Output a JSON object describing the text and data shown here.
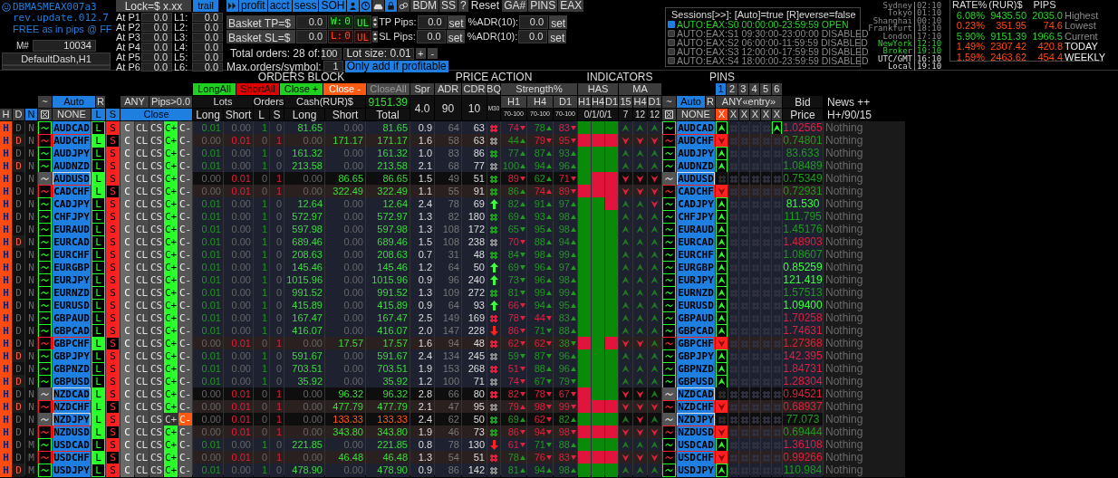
{
  "brand": {
    "title": "DBMASMEAX007a3",
    "revision": "rev.update.012.7",
    "tagline": "FREE as in pips @ FF",
    "magic_label": "M#",
    "magic": "10034",
    "profile": "DefaultDash,H1"
  },
  "lock": {
    "value": "Lock=$ x.xx",
    "trail": "trail"
  },
  "levels": [
    {
      "p": "At P1",
      "pv": "0.0",
      "l": "L1:",
      "lv": "0.0"
    },
    {
      "p": "At P2",
      "pv": "0.0",
      "l": "L2:",
      "lv": "0.0"
    },
    {
      "p": "At P3",
      "pv": "0.0",
      "l": "L3:",
      "lv": "0.0"
    },
    {
      "p": "At P4",
      "pv": "0.0",
      "l": "L4:",
      "lv": "0.0"
    },
    {
      "p": "At P5",
      "pv": "0.0",
      "l": "L5:",
      "lv": "0.0"
    },
    {
      "p": "At P6",
      "pv": "0.0",
      "l": "L6:",
      "lv": "0.0"
    }
  ],
  "toolbar": [
    {
      "kind": "icon"
    },
    {
      "kind": "blue",
      "label": "profit"
    },
    {
      "kind": "blue",
      "label": "acct"
    },
    {
      "kind": "blue",
      "label": "sess"
    },
    {
      "kind": "blue",
      "label": "SOH"
    },
    {
      "kind": "icon"
    },
    {
      "kind": "icon"
    },
    {
      "kind": "icon"
    },
    {
      "kind": "icon"
    },
    {
      "kind": "icon"
    },
    {
      "kind": "gray",
      "label": "BDM"
    },
    {
      "kind": "gray",
      "label": "SS"
    },
    {
      "kind": "gray",
      "label": "?"
    },
    {
      "kind": "plain",
      "label": "Reset"
    },
    {
      "kind": "gray",
      "label": "GA#"
    },
    {
      "kind": "gray",
      "label": "PINS"
    },
    {
      "kind": "gray",
      "label": "EAX"
    }
  ],
  "baskets": [
    {
      "label": "Basket TP=$",
      "value": "0.0",
      "win": true,
      "flag": "W:",
      "count": "0",
      "ul": "UL",
      "pips_label": "TP Pips:",
      "pips": "0.0",
      "set": "set",
      "adr_label": "%ADR(10):",
      "adr": "0.0",
      "set2": "set"
    },
    {
      "label": "Basket SL=$",
      "value": "0.0",
      "win": false,
      "flag": "L:",
      "count": "0",
      "ul": "UL",
      "pips_label": "SL Pips:",
      "pips": "0.0",
      "set": "set",
      "adr_label": "%ADR(10):",
      "adr": "0.0",
      "set2": "set"
    }
  ],
  "orders": {
    "total_label": "Total orders: 28 of:",
    "max": "100",
    "lot": "Lot size: 0.01",
    "plus": "+",
    "minus": "-",
    "per_symbol_label": "Max.orders/symbol:",
    "per_symbol": "1",
    "only_profitable": "Only add if profitable"
  },
  "sessions": {
    "title": "Sessions[>>]: [Auto]=true [R]everse=false",
    "items": [
      {
        "label": "AUTO:EAX:S0 00:00:00-23:59:59 OPEN",
        "on": true
      },
      {
        "label": "AUTO:EAX:S1 09:30:00-23:00:00 DISABLED",
        "on": false
      },
      {
        "label": "AUTO:EAX:S2 06:00:00-11:59:59 DISABLED",
        "on": false
      },
      {
        "label": "AUTO:EAX:S3 12:00:00-17:59:59 DISABLED",
        "on": false
      },
      {
        "label": "AUTO:EAX:S4 18:00:00-23:59:59 DISABLED",
        "on": false
      }
    ]
  },
  "clocks": [
    {
      "city": "Sydney",
      "time": "02:10",
      "dim": true,
      "live": false
    },
    {
      "city": "Tokyo",
      "time": "01:10",
      "dim": true,
      "live": false
    },
    {
      "city": "Shanghai",
      "time": "00:10",
      "dim": true,
      "live": false
    },
    {
      "city": "Frankfurt",
      "time": "18:10",
      "dim": true,
      "live": false
    },
    {
      "city": "London",
      "time": "17:10",
      "dim": true,
      "live": false
    },
    {
      "city": "NewYork",
      "time": "12:10",
      "dim": false,
      "live": true
    },
    {
      "city": "Broker",
      "time": "19:10",
      "dim": false,
      "live": true
    },
    {
      "city": "UTC/GMT",
      "time": "16:10",
      "dim": false,
      "live": false
    },
    {
      "city": "Local",
      "time": "19:10",
      "dim": false,
      "live": false
    }
  ],
  "stats": {
    "columns": [
      "RATE%",
      "(RUR)$",
      "PIPS"
    ],
    "rows": [
      {
        "rate": "6.08%",
        "cash": "9435.50",
        "pips": "2035.0",
        "label": "Highest",
        "gain": true,
        "emph": false
      },
      {
        "rate": "0.23%",
        "cash": "351.95",
        "pips": "74.6",
        "label": "Lowest",
        "gain": false,
        "emph": false
      },
      {
        "rate": "5.90%",
        "cash": "9151.39",
        "pips": "1966.5",
        "label": "Current",
        "gain": true,
        "emph": false
      },
      {
        "rate": "1.49%",
        "cash": "2307.42",
        "pips": "420.8",
        "label": "TODAY",
        "gain": false,
        "emph": true
      },
      {
        "rate": "1.59%",
        "cash": "2463.62",
        "pips": "454.4",
        "label": "WEEKLY",
        "gain": false,
        "emph": true
      }
    ]
  },
  "header": {
    "orders_title": "ORDERS BLOCK",
    "price_title": "PRICE ACTION",
    "ind_title": "INDICATORS",
    "pins_title": "PINS",
    "bulk": [
      "LongAll",
      "ShortAll",
      "Close +",
      "Close -",
      "CloseAll"
    ],
    "left_mode": {
      "tilde": "~",
      "auto": "Auto",
      "r": "R"
    },
    "any": "ANY",
    "pips_filter": "Pips>0.0",
    "flags": [
      "H",
      "D",
      "N"
    ],
    "none": "NONE",
    "l": "L",
    "s": "S",
    "close": "Close",
    "lots": "Lots",
    "orders": "Orders",
    "cash": "Cash(RUR)$",
    "cash_total": "9151.39",
    "sub": [
      "Long",
      "Short",
      "L",
      "S",
      "Long",
      "Short",
      "Total"
    ],
    "spr": "Spr",
    "adr": "ADR",
    "cdr": "CDR",
    "bq": "BQ",
    "spr_v": "4.0",
    "adr_v": "90",
    "cdr_v": "10",
    "bq_v": "M30",
    "strength": "Strength%",
    "tf": [
      "H1",
      "H4",
      "D1"
    ],
    "tf_range": [
      "70-100",
      "70-100",
      "70-100"
    ],
    "has": "HAS",
    "ma": "MA",
    "has_tf": [
      "H1",
      "H4",
      "D1"
    ],
    "ma_tf": [
      "15",
      "H4",
      "D1"
    ],
    "has_v": "0/1/0/1",
    "ma_v": [
      "7",
      "12",
      "12"
    ],
    "right_mode": {
      "tilde": "~",
      "auto": "Auto",
      "r": "R"
    },
    "right_none": "NONE",
    "pin_tabs": [
      {
        "label": "1",
        "selected": true
      },
      {
        "label": "2",
        "selected": false
      },
      {
        "label": "3",
        "selected": false
      },
      {
        "label": "4",
        "selected": false
      },
      {
        "label": "5",
        "selected": false
      },
      {
        "label": "6",
        "selected": false
      }
    ],
    "entry": "ANY«entry»",
    "pin_x": [
      {
        "label": "X",
        "on": true
      },
      {
        "label": "X",
        "on": false
      },
      {
        "label": "X",
        "on": false
      },
      {
        "label": "X",
        "on": false
      },
      {
        "label": "X",
        "on": false
      },
      {
        "label": "X",
        "on": false
      }
    ],
    "bid": "Bid",
    "price": "Price",
    "news": "News ++",
    "news_v": "H+/90/15"
  },
  "rows": [
    {
      "sym": "AUDCAD",
      "long": true,
      "idle": false,
      "d": false,
      "cm": false,
      "loss": false,
      "hit": true,
      "btn": [
        "H",
        "D",
        "N",
        "L",
        "S",
        "C",
        "CL",
        "CS",
        "C+",
        "C-"
      ],
      "ll": "0.01",
      "ls": "0.00",
      "ol": "1",
      "os": "0",
      "cl": "81.65",
      "cs": "0.00",
      "tot": "81.65",
      "spr": "0.9",
      "adr": "64",
      "cdr": "63",
      "bq": {
        "kind": "hash",
        "color": "#e0203c"
      },
      "st": [
        [
          "74",
          false,
          false
        ],
        [
          "78",
          true,
          true
        ],
        [
          "83",
          false,
          false
        ]
      ],
      "has": [
        true,
        true,
        true
      ],
      "ma": [
        true,
        true,
        true
      ],
      "sym2": "AUDCAD",
      "bid": {
        "value": "1.02565",
        "color": "#e0203c"
      },
      "news": "Nothing"
    },
    {
      "sym": "AUDCHF",
      "long": false,
      "idle": false,
      "d": true,
      "cm": false,
      "loss": false,
      "hit": false,
      "btn": [
        "H",
        "D",
        "N",
        "L",
        "S",
        "C",
        "CL",
        "CS",
        "C+",
        "C-"
      ],
      "ll": "0.00",
      "ls": "0.01",
      "ol": "0",
      "os": "1",
      "cl": "0.00",
      "cs": "171.17",
      "tot": "171.17",
      "spr": "1.6",
      "adr": "58",
      "cdr": "63",
      "bq": {
        "kind": "hash",
        "color": "#8a8a8a"
      },
      "st": [
        [
          "44",
          true,
          true
        ],
        [
          "79",
          false,
          false
        ],
        [
          "95",
          false,
          false
        ]
      ],
      "has": [
        false,
        false,
        false
      ],
      "ma": [
        false,
        false,
        false
      ],
      "sym2": "AUDCHF",
      "bid": {
        "value": "0.74801",
        "color": "#1f9a1f"
      },
      "news": "Nothing"
    },
    {
      "sym": "AUDJPY",
      "long": true,
      "idle": false,
      "d": false,
      "cm": false,
      "loss": false,
      "hit": false,
      "btn": [
        "H",
        "D",
        "N",
        "L",
        "S",
        "C",
        "CL",
        "CS",
        "C+",
        "C-"
      ],
      "ll": "0.01",
      "ls": "0.00",
      "ol": "1",
      "os": "0",
      "cl": "161.32",
      "cs": "0.00",
      "tot": "161.32",
      "spr": "1.0",
      "adr": "83",
      "cdr": "86",
      "bq": {
        "kind": "hash",
        "color": "#1f9a1f"
      },
      "st": [
        [
          "77",
          true,
          true
        ],
        [
          "87",
          true,
          true
        ],
        [
          "93",
          true,
          true
        ]
      ],
      "has": [
        true,
        true,
        true
      ],
      "ma": [
        true,
        true,
        true
      ],
      "sym2": "AUDJPY",
      "bid": {
        "value": "83.633",
        "color": "#1f9a1f"
      },
      "news": "Nothing"
    },
    {
      "sym": "AUDNZD",
      "long": true,
      "idle": false,
      "d": true,
      "cm": false,
      "loss": false,
      "hit": false,
      "btn": [
        "H",
        "D",
        "N",
        "L",
        "S",
        "C",
        "CL",
        "CS",
        "C+",
        "C-"
      ],
      "ll": "0.01",
      "ls": "0.00",
      "ol": "1",
      "os": "0",
      "cl": "213.58",
      "cs": "0.00",
      "tot": "213.58",
      "spr": "2.1",
      "adr": "68",
      "cdr": "77",
      "bq": {
        "kind": "hash",
        "color": "#8a8a8a"
      },
      "st": [
        [
          "100",
          true,
          true
        ],
        [
          "94",
          true,
          true
        ],
        [
          "96",
          true,
          true
        ]
      ],
      "has": [
        true,
        true,
        true
      ],
      "ma": [
        true,
        true,
        true
      ],
      "sym2": "AUDNZD",
      "bid": {
        "value": "1.08489",
        "color": "#1f9a1f"
      },
      "news": "Nothing"
    },
    {
      "sym": "AUDUSD",
      "long": false,
      "idle": true,
      "d": false,
      "cm": false,
      "loss": false,
      "hit": false,
      "btn": [
        "H",
        "D",
        "N",
        "L",
        "S",
        "C",
        "CL",
        "CS",
        "C+",
        "C-"
      ],
      "ll": "0.00",
      "ls": "0.01",
      "ol": "0",
      "os": "1",
      "cl": "0.00",
      "cs": "86.65",
      "tot": "86.65",
      "spr": "1.5",
      "adr": "49",
      "cdr": "51",
      "bq": {
        "kind": "hash",
        "color": "#1f9a1f"
      },
      "st": [
        [
          "89",
          false,
          false
        ],
        [
          "62",
          true,
          true
        ],
        [
          "71",
          false,
          false
        ]
      ],
      "has": [
        true,
        false,
        false
      ],
      "ma": [
        false,
        false,
        false
      ],
      "sym2": "AUDUSD",
      "bid": {
        "value": "0.75349",
        "color": "#1f9a1f"
      },
      "news": "Nothing"
    },
    {
      "sym": "CADCHF",
      "long": false,
      "idle": false,
      "d": false,
      "cm": false,
      "loss": false,
      "hit": false,
      "btn": [
        "H",
        "D",
        "N",
        "L",
        "S",
        "C",
        "CL",
        "CS",
        "C+",
        "C-"
      ],
      "ll": "0.00",
      "ls": "0.01",
      "ol": "0",
      "os": "1",
      "cl": "0.00",
      "cs": "322.49",
      "tot": "322.49",
      "spr": "1.1",
      "adr": "55",
      "cdr": "91",
      "bq": {
        "kind": "hash",
        "color": "#1f9a1f"
      },
      "st": [
        [
          "86",
          true,
          true
        ],
        [
          "74",
          true,
          false
        ],
        [
          "89",
          false,
          false
        ]
      ],
      "has": [
        false,
        false,
        false
      ],
      "ma": [
        false,
        false,
        false
      ],
      "sym2": "CADCHF",
      "bid": {
        "value": "0.72931",
        "color": "#1f9a1f"
      },
      "news": "Nothing"
    },
    {
      "sym": "CADJPY",
      "long": true,
      "idle": false,
      "d": false,
      "cm": false,
      "loss": false,
      "hit": false,
      "btn": [
        "H",
        "D",
        "N",
        "L",
        "S",
        "C",
        "CL",
        "CS",
        "C+",
        "C-"
      ],
      "ll": "0.01",
      "ls": "0.00",
      "ol": "1",
      "os": "0",
      "cl": "12.64",
      "cs": "0.00",
      "tot": "12.64",
      "spr": "2.4",
      "adr": "78",
      "cdr": "69",
      "bq": {
        "kind": "up",
        "color": "#3cff3c"
      },
      "st": [
        [
          "82",
          true,
          true
        ],
        [
          "91",
          true,
          true
        ],
        [
          "97",
          true,
          true
        ]
      ],
      "has": [
        true,
        true,
        false
      ],
      "ma": [
        true,
        true,
        false
      ],
      "sym2": "CADJPY",
      "bid": {
        "value": "81.530",
        "color": "#3cff3c"
      },
      "news": "Nothing"
    },
    {
      "sym": "CHFJPY",
      "long": true,
      "idle": false,
      "d": false,
      "cm": false,
      "loss": false,
      "hit": false,
      "btn": [
        "H",
        "D",
        "N",
        "L",
        "S",
        "C",
        "CL",
        "CS",
        "C+",
        "C-"
      ],
      "ll": "0.01",
      "ls": "0.00",
      "ol": "1",
      "os": "0",
      "cl": "572.97",
      "cs": "0.00",
      "tot": "572.97",
      "spr": "1.3",
      "adr": "82",
      "cdr": "180",
      "bq": {
        "kind": "hash",
        "color": "#1f9a1f"
      },
      "st": [
        [
          "69",
          true,
          true
        ],
        [
          "93",
          true,
          true
        ],
        [
          "98",
          true,
          true
        ]
      ],
      "has": [
        true,
        true,
        true
      ],
      "ma": [
        true,
        true,
        true
      ],
      "sym2": "CHFJPY",
      "bid": {
        "value": "111.795",
        "color": "#1f9a1f"
      },
      "news": "Nothing"
    },
    {
      "sym": "EURAUD",
      "long": true,
      "idle": false,
      "d": false,
      "cm": false,
      "loss": false,
      "hit": false,
      "btn": [
        "H",
        "D",
        "N",
        "L",
        "S",
        "C",
        "CL",
        "CS",
        "C+",
        "C-"
      ],
      "ll": "0.01",
      "ls": "0.00",
      "ol": "1",
      "os": "0",
      "cl": "597.98",
      "cs": "0.00",
      "tot": "597.98",
      "spr": "1.3",
      "adr": "108",
      "cdr": "172",
      "bq": {
        "kind": "hash",
        "color": "#1f9a1f"
      },
      "st": [
        [
          "65",
          false,
          true
        ],
        [
          "95",
          true,
          true
        ],
        [
          "98",
          true,
          true
        ]
      ],
      "has": [
        true,
        true,
        true
      ],
      "ma": [
        true,
        true,
        true
      ],
      "sym2": "EURAUD",
      "bid": {
        "value": "1.45176",
        "color": "#1f9a1f"
      },
      "news": "Nothing"
    },
    {
      "sym": "EURCAD",
      "long": true,
      "idle": false,
      "d": true,
      "cm": false,
      "loss": false,
      "hit": false,
      "btn": [
        "H",
        "D",
        "N",
        "L",
        "S",
        "C",
        "CL",
        "CS",
        "C+",
        "C-"
      ],
      "ll": "0.01",
      "ls": "0.00",
      "ol": "1",
      "os": "0",
      "cl": "689.46",
      "cs": "0.00",
      "tot": "689.46",
      "spr": "1.5",
      "adr": "108",
      "cdr": "238",
      "bq": {
        "kind": "hash",
        "color": "#8a8a8a"
      },
      "st": [
        [
          "70",
          false,
          false
        ],
        [
          "88",
          true,
          true
        ],
        [
          "94",
          true,
          true
        ]
      ],
      "has": [
        true,
        true,
        true
      ],
      "ma": [
        true,
        true,
        true
      ],
      "sym2": "EURCAD",
      "bid": {
        "value": "1.48903",
        "color": "#e0203c"
      },
      "news": "Nothing"
    },
    {
      "sym": "EURCHF",
      "long": true,
      "idle": false,
      "d": false,
      "cm": false,
      "loss": false,
      "hit": false,
      "btn": [
        "H",
        "D",
        "N",
        "L",
        "S",
        "C",
        "CL",
        "CS",
        "C+",
        "C-"
      ],
      "ll": "0.01",
      "ls": "0.00",
      "ol": "1",
      "os": "0",
      "cl": "208.63",
      "cs": "0.00",
      "tot": "208.63",
      "spr": "0.7",
      "adr": "31",
      "cdr": "48",
      "bq": {
        "kind": "hash",
        "color": "#1f9a1f"
      },
      "st": [
        [
          "84",
          false,
          true
        ],
        [
          "98",
          true,
          true
        ],
        [
          "99",
          true,
          true
        ]
      ],
      "has": [
        true,
        true,
        true
      ],
      "ma": [
        true,
        true,
        true
      ],
      "sym2": "EURCHF",
      "bid": {
        "value": "1.08607",
        "color": "#1f9a1f"
      },
      "news": "Nothing"
    },
    {
      "sym": "EURGBP",
      "long": true,
      "idle": false,
      "d": false,
      "cm": false,
      "loss": false,
      "hit": false,
      "btn": [
        "H",
        "D",
        "N",
        "L",
        "S",
        "C",
        "CL",
        "CS",
        "C+",
        "C-"
      ],
      "ll": "0.01",
      "ls": "0.00",
      "ol": "1",
      "os": "0",
      "cl": "145.46",
      "cs": "0.00",
      "tot": "145.46",
      "spr": "1.2",
      "adr": "64",
      "cdr": "50",
      "bq": {
        "kind": "up",
        "color": "#3cff3c"
      },
      "st": [
        [
          "69",
          false,
          true
        ],
        [
          "96",
          true,
          true
        ],
        [
          "97",
          true,
          true
        ]
      ],
      "has": [
        true,
        true,
        true
      ],
      "ma": [
        true,
        true,
        true
      ],
      "sym2": "EURGBP",
      "bid": {
        "value": "0.85259",
        "color": "#3cff3c"
      },
      "news": "Nothing"
    },
    {
      "sym": "EURJPY",
      "long": true,
      "idle": false,
      "d": false,
      "cm": false,
      "loss": false,
      "hit": false,
      "btn": [
        "H",
        "D",
        "N",
        "L",
        "S",
        "C",
        "CL",
        "CS",
        "C+",
        "C-"
      ],
      "ll": "0.01",
      "ls": "0.00",
      "ol": "1",
      "os": "0",
      "cl": "1015.96",
      "cs": "0.00",
      "tot": "1015.96",
      "spr": "0.9",
      "adr": "96",
      "cdr": "240",
      "bq": {
        "kind": "up",
        "color": "#3cff3c"
      },
      "st": [
        [
          "73",
          false,
          true
        ],
        [
          "96",
          true,
          true
        ],
        [
          "98",
          true,
          true
        ]
      ],
      "has": [
        true,
        true,
        true
      ],
      "ma": [
        true,
        true,
        true
      ],
      "sym2": "EURJPY",
      "bid": {
        "value": "121.419",
        "color": "#3cff3c"
      },
      "news": "Nothing"
    },
    {
      "sym": "EURNZD",
      "long": true,
      "idle": false,
      "d": false,
      "cm": false,
      "loss": false,
      "hit": false,
      "btn": [
        "H",
        "D",
        "N",
        "L",
        "S",
        "C",
        "CL",
        "CS",
        "C+",
        "C-"
      ],
      "ll": "0.01",
      "ls": "0.00",
      "ol": "1",
      "os": "0",
      "cl": "991.52",
      "cs": "0.00",
      "tot": "991.52",
      "spr": "1.3",
      "adr": "109",
      "cdr": "272",
      "bq": {
        "kind": "hash",
        "color": "#1f9a1f"
      },
      "st": [
        [
          "81",
          false,
          true
        ],
        [
          "99",
          true,
          true
        ],
        [
          "99",
          true,
          true
        ]
      ],
      "has": [
        true,
        true,
        true
      ],
      "ma": [
        true,
        true,
        true
      ],
      "sym2": "EURNZD",
      "bid": {
        "value": "1.57513",
        "color": "#1f9a1f"
      },
      "news": "Nothing"
    },
    {
      "sym": "EURUSD",
      "long": true,
      "idle": false,
      "d": false,
      "cm": false,
      "loss": false,
      "hit": false,
      "btn": [
        "H",
        "D",
        "N",
        "L",
        "S",
        "C",
        "CL",
        "CS",
        "C+",
        "C-"
      ],
      "ll": "0.01",
      "ls": "0.00",
      "ol": "1",
      "os": "0",
      "cl": "415.89",
      "cs": "0.00",
      "tot": "415.89",
      "spr": "0.9",
      "adr": "64",
      "cdr": "93",
      "bq": {
        "kind": "up",
        "color": "#3cff3c"
      },
      "st": [
        [
          "66",
          false,
          false
        ],
        [
          "94",
          true,
          true
        ],
        [
          "95",
          true,
          true
        ]
      ],
      "has": [
        true,
        true,
        true
      ],
      "ma": [
        true,
        true,
        true
      ],
      "sym2": "EURUSD",
      "bid": {
        "value": "1.09400",
        "color": "#3cff3c"
      },
      "news": "Nothing"
    },
    {
      "sym": "GBPAUD",
      "long": true,
      "idle": false,
      "d": false,
      "cm": false,
      "loss": false,
      "hit": false,
      "btn": [
        "H",
        "D",
        "N",
        "L",
        "S",
        "C",
        "CL",
        "CS",
        "C+",
        "C-"
      ],
      "ll": "0.01",
      "ls": "0.00",
      "ol": "1",
      "os": "0",
      "cl": "167.47",
      "cs": "0.00",
      "tot": "167.47",
      "spr": "2.5",
      "adr": "149",
      "cdr": "169",
      "bq": {
        "kind": "hash",
        "color": "#e0203c"
      },
      "st": [
        [
          "78",
          false,
          false
        ],
        [
          "44",
          false,
          false
        ],
        [
          "83",
          true,
          true
        ]
      ],
      "has": [
        true,
        true,
        true
      ],
      "ma": [
        true,
        true,
        true
      ],
      "sym2": "GBPAUD",
      "bid": {
        "value": "1.70258",
        "color": "#e0203c"
      },
      "news": "Nothing"
    },
    {
      "sym": "GBPCAD",
      "long": true,
      "idle": false,
      "d": false,
      "cm": false,
      "loss": false,
      "hit": false,
      "btn": [
        "H",
        "D",
        "N",
        "L",
        "S",
        "C",
        "CL",
        "CS",
        "C+",
        "C-"
      ],
      "ll": "0.01",
      "ls": "0.00",
      "ol": "1",
      "os": "0",
      "cl": "416.07",
      "cs": "0.00",
      "tot": "416.07",
      "spr": "2.0",
      "adr": "147",
      "cdr": "228",
      "bq": {
        "kind": "down",
        "color": "#ff2020"
      },
      "st": [
        [
          "86",
          false,
          false
        ],
        [
          "71",
          false,
          true
        ],
        [
          "88",
          true,
          true
        ]
      ],
      "has": [
        true,
        true,
        true
      ],
      "ma": [
        true,
        true,
        true
      ],
      "sym2": "GBPCAD",
      "bid": {
        "value": "1.74631",
        "color": "#e0203c"
      },
      "news": "Nothing"
    },
    {
      "sym": "GBPCHF",
      "long": false,
      "idle": false,
      "d": false,
      "cm": false,
      "loss": false,
      "hit": false,
      "btn": [
        "H",
        "D",
        "N",
        "L",
        "S",
        "C",
        "CL",
        "CS",
        "C+",
        "C-"
      ],
      "ll": "0.00",
      "ls": "0.01",
      "ol": "0",
      "os": "1",
      "cl": "0.00",
      "cs": "17.57",
      "tot": "17.57",
      "spr": "1.6",
      "adr": "94",
      "cdr": "48",
      "bq": {
        "kind": "hash",
        "color": "#e0203c"
      },
      "st": [
        [
          "62",
          false,
          false
        ],
        [
          "62",
          false,
          false
        ],
        [
          "38",
          false,
          true
        ]
      ],
      "has": [
        false,
        true,
        false
      ],
      "ma": [
        false,
        false,
        true
      ],
      "sym2": "GBPCHF",
      "bid": {
        "value": "1.27368",
        "color": "#e0203c"
      },
      "news": "Nothing"
    },
    {
      "sym": "GBPJPY",
      "long": true,
      "idle": false,
      "d": true,
      "cm": false,
      "loss": false,
      "hit": false,
      "btn": [
        "H",
        "D",
        "N",
        "L",
        "S",
        "C",
        "CL",
        "CS",
        "C+",
        "C-"
      ],
      "ll": "0.01",
      "ls": "0.00",
      "ol": "1",
      "os": "0",
      "cl": "591.67",
      "cs": "0.00",
      "tot": "591.67",
      "spr": "2.4",
      "adr": "134",
      "cdr": "245",
      "bq": {
        "kind": "hash",
        "color": "#8a8a8a"
      },
      "st": [
        [
          "59",
          false,
          true
        ],
        [
          "87",
          false,
          true
        ],
        [
          "96",
          true,
          true
        ]
      ],
      "has": [
        true,
        true,
        true
      ],
      "ma": [
        true,
        true,
        true
      ],
      "sym2": "GBPJPY",
      "bid": {
        "value": "142.395",
        "color": "#e0203c"
      },
      "news": "Nothing"
    },
    {
      "sym": "GBPNZD",
      "long": true,
      "idle": false,
      "d": false,
      "cm": false,
      "loss": false,
      "hit": false,
      "btn": [
        "H",
        "D",
        "N",
        "L",
        "S",
        "C",
        "CL",
        "CS",
        "C+",
        "C-"
      ],
      "ll": "0.01",
      "ls": "0.00",
      "ol": "1",
      "os": "0",
      "cl": "703.51",
      "cs": "0.00",
      "tot": "703.51",
      "spr": "1.9",
      "adr": "153",
      "cdr": "268",
      "bq": {
        "kind": "hash",
        "color": "#e0203c"
      },
      "st": [
        [
          "51",
          false,
          false
        ],
        [
          "88",
          true,
          true
        ],
        [
          "96",
          true,
          true
        ]
      ],
      "has": [
        true,
        true,
        true
      ],
      "ma": [
        true,
        true,
        true
      ],
      "sym2": "GBPNZD",
      "bid": {
        "value": "1.84731",
        "color": "#e0203c"
      },
      "news": "Nothing"
    },
    {
      "sym": "GBPUSD",
      "long": true,
      "idle": false,
      "d": true,
      "cm": false,
      "loss": false,
      "hit": false,
      "btn": [
        "H",
        "D",
        "N",
        "L",
        "S",
        "C",
        "CL",
        "CS",
        "C+",
        "C-"
      ],
      "ll": "0.01",
      "ls": "0.00",
      "ol": "1",
      "os": "0",
      "cl": "35.92",
      "cs": "0.00",
      "tot": "35.92",
      "spr": "1.2",
      "adr": "100",
      "cdr": "71",
      "bq": {
        "kind": "hash",
        "color": "#8a8a8a"
      },
      "st": [
        [
          "74",
          false,
          false
        ],
        [
          "67",
          false,
          true
        ],
        [
          "79",
          false,
          true
        ]
      ],
      "has": [
        true,
        true,
        true
      ],
      "ma": [
        true,
        true,
        true
      ],
      "sym2": "GBPUSD",
      "bid": {
        "value": "1.28304",
        "color": "#e0203c"
      },
      "news": "Nothing"
    },
    {
      "sym": "NZDCAD",
      "long": false,
      "idle": true,
      "d": false,
      "cm": false,
      "loss": false,
      "hit": false,
      "btn": [
        "H",
        "D",
        "N",
        "L",
        "S",
        "C",
        "CL",
        "CS",
        "C+",
        "C-"
      ],
      "ll": "0.00",
      "ls": "0.01",
      "ol": "0",
      "os": "1",
      "cl": "0.00",
      "cs": "96.32",
      "tot": "96.32",
      "spr": "2.8",
      "adr": "66",
      "cdr": "80",
      "bq": {
        "kind": "hash",
        "color": "#e0203c"
      },
      "st": [
        [
          "82",
          false,
          false
        ],
        [
          "78",
          false,
          false
        ],
        [
          "67",
          false,
          false
        ]
      ],
      "has": [
        false,
        true,
        true
      ],
      "ma": [
        false,
        false,
        true
      ],
      "sym2": "NZDCAD",
      "bid": {
        "value": "0.94521",
        "color": "#e0203c"
      },
      "news": "Nothing"
    },
    {
      "sym": "NZDCHF",
      "long": false,
      "idle": false,
      "d": true,
      "cm": false,
      "loss": false,
      "hit": false,
      "btn": [
        "H",
        "D",
        "N",
        "L",
        "S",
        "C",
        "CL",
        "CS",
        "C+",
        "C-"
      ],
      "ll": "0.00",
      "ls": "0.01",
      "ol": "0",
      "os": "1",
      "cl": "0.00",
      "cs": "477.79",
      "tot": "477.79",
      "spr": "2.1",
      "adr": "47",
      "cdr": "95",
      "bq": {
        "kind": "hash",
        "color": "#8a8a8a"
      },
      "st": [
        [
          "79",
          true,
          false
        ],
        [
          "98",
          false,
          false
        ],
        [
          "99",
          false,
          false
        ]
      ],
      "has": [
        false,
        false,
        false
      ],
      "ma": [
        false,
        false,
        false
      ],
      "sym2": "NZDCHF",
      "bid": {
        "value": "0.68937",
        "color": "#e0203c"
      },
      "news": "Nothing"
    },
    {
      "sym": "NZDJPY",
      "long": false,
      "idle": true,
      "d": false,
      "cm": true,
      "loss": true,
      "hit": false,
      "btn": [
        "H",
        "D",
        "N",
        "L",
        "S",
        "C",
        "CL",
        "CS",
        "C+",
        "C-"
      ],
      "ll": "0.00",
      "ls": "0.01",
      "ol": "0",
      "os": "1",
      "cl": "0.00",
      "cs": "133.33",
      "tot": "133.33",
      "spr": "2.4",
      "adr": "62",
      "cdr": "50",
      "bq": {
        "kind": "hash",
        "color": "#1f9a1f"
      },
      "st": [
        [
          "69",
          true,
          true
        ],
        [
          "62",
          false,
          false
        ],
        [
          "82",
          true,
          true
        ]
      ],
      "has": [
        true,
        true,
        true
      ],
      "ma": [
        true,
        false,
        true
      ],
      "sym2": "NZDJPY",
      "bid": {
        "value": "77.073",
        "color": "#1f9a1f"
      },
      "news": "Nothing"
    },
    {
      "sym": "NZDUSD",
      "long": false,
      "idle": false,
      "d": false,
      "cm": false,
      "loss": false,
      "hit": false,
      "btn": [
        "H",
        "D",
        "N",
        "L",
        "S",
        "C",
        "CL",
        "CS",
        "C+",
        "C-"
      ],
      "ll": "0.00",
      "ls": "0.01",
      "ol": "0",
      "os": "1",
      "cl": "0.00",
      "cs": "343.80",
      "tot": "343.80",
      "spr": "1.9",
      "adr": "46",
      "cdr": "73",
      "bq": {
        "kind": "hash",
        "color": "#1f9a1f"
      },
      "st": [
        [
          "86",
          false,
          false
        ],
        [
          "94",
          false,
          false
        ],
        [
          "98",
          false,
          false
        ]
      ],
      "has": [
        false,
        false,
        false
      ],
      "ma": [
        false,
        false,
        false
      ],
      "sym2": "NZDUSD",
      "bid": {
        "value": "0.69444",
        "color": "#1f9a1f"
      },
      "news": "Nothing"
    },
    {
      "sym": "USDCAD",
      "long": true,
      "idle": false,
      "d": false,
      "cm": false,
      "loss": false,
      "hit": false,
      "btn": [
        "H",
        "D",
        "M",
        "L",
        "S",
        "C",
        "CL",
        "CS",
        "C+",
        "C-"
      ],
      "ll": "0.01",
      "ls": "0.00",
      "ol": "1",
      "os": "0",
      "cl": "221.85",
      "cs": "0.00",
      "tot": "221.85",
      "spr": "0.8",
      "adr": "78",
      "cdr": "130",
      "bq": {
        "kind": "down",
        "color": "#ff2020"
      },
      "st": [
        [
          "61",
          false,
          false
        ],
        [
          "71",
          false,
          true
        ],
        [
          "88",
          true,
          true
        ]
      ],
      "has": [
        true,
        true,
        true
      ],
      "ma": [
        true,
        true,
        true
      ],
      "sym2": "USDCAD",
      "bid": {
        "value": "1.36108",
        "color": "#e0203c"
      },
      "news": "Nothing"
    },
    {
      "sym": "USDCHF",
      "long": false,
      "idle": false,
      "d": false,
      "cm": false,
      "loss": false,
      "hit": false,
      "btn": [
        "H",
        "D",
        "M",
        "L",
        "S",
        "C",
        "CL",
        "CS",
        "C+",
        "C-"
      ],
      "ll": "0.00",
      "ls": "0.01",
      "ol": "0",
      "os": "1",
      "cl": "0.00",
      "cs": "46.48",
      "tot": "46.48",
      "spr": "1.3",
      "adr": "54",
      "cdr": "51",
      "bq": {
        "kind": "hash",
        "color": "#e0203c"
      },
      "st": [
        [
          "78",
          true,
          true
        ],
        [
          "76",
          false,
          false
        ],
        [
          "83",
          false,
          false
        ]
      ],
      "has": [
        false,
        false,
        false
      ],
      "ma": [
        false,
        false,
        false
      ],
      "sym2": "USDCHF",
      "bid": {
        "value": "0.99266",
        "color": "#e0203c"
      },
      "news": "Nothing"
    },
    {
      "sym": "USDJPY",
      "long": true,
      "idle": false,
      "d": true,
      "cm": false,
      "loss": false,
      "hit": false,
      "btn": [
        "H",
        "D",
        "M",
        "L",
        "S",
        "C",
        "CL",
        "CS",
        "C+",
        "C-"
      ],
      "ll": "0.01",
      "ls": "0.00",
      "ol": "1",
      "os": "0",
      "cl": "478.90",
      "cs": "0.00",
      "tot": "478.90",
      "spr": "0.9",
      "adr": "86",
      "cdr": "142",
      "bq": {
        "kind": "hash",
        "color": "#8a8a8a"
      },
      "st": [
        [
          "81",
          true,
          true
        ],
        [
          "94",
          true,
          true
        ],
        [
          "98",
          true,
          true
        ]
      ],
      "has": [
        true,
        true,
        true
      ],
      "ma": [
        true,
        true,
        true
      ],
      "sym2": "USDJPY",
      "bid": {
        "value": "110.984",
        "color": "#1f9a1f"
      },
      "news": "Nothing"
    }
  ]
}
